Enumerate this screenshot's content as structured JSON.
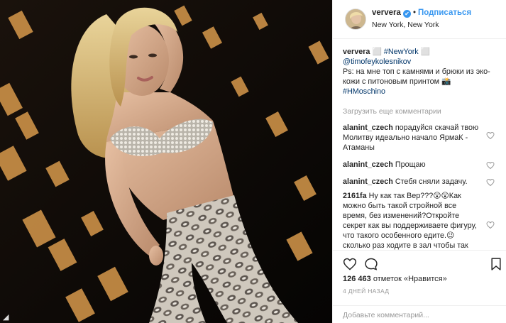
{
  "post": {
    "username": "ververa",
    "verified_mark": "✔",
    "separator": "•",
    "follow_label": "Подписаться",
    "location": "New York, New York",
    "photo_corner_glyph": "◢"
  },
  "caption": {
    "username": "ververa",
    "emoji1": "⬜",
    "hashtag1": "#NewYork",
    "emoji2": "⬜",
    "mention": "@timofeykolesnikov",
    "text": "Ps: на мне топ с камнями и брюки из эко-кожи с питоновым принтом 📸",
    "hashtag2": "#HMoschino"
  },
  "load_more_label": "Загрузить еще комментарии",
  "comments": [
    {
      "user": "alanint_czech",
      "text": "порадуйся скачай твою Молитву идеально начало ЯрмаК - Атаманы"
    },
    {
      "user": "alanint_czech",
      "text": "Прощаю"
    },
    {
      "user": "alanint_czech",
      "text": "Стебя сняли задачу."
    },
    {
      "user": "2161fa",
      "text": "Ну как так Вер???😲😲Как можно быть такой стройной все время, без изменений?Откройте секрет как вы поддерживаете фигуру, что такого особенного едите.😉 сколько раз ходите в зал чтобы так выглядеть???😍😍😍 @ververa"
    }
  ],
  "likes": {
    "count": "126 463",
    "text": "отметок «Нравится»"
  },
  "time_ago": "4 ДНЕЙ НАЗАД",
  "add_comment_placeholder": "Добавьте комментарий...",
  "icons": {
    "like": "heart-outline",
    "comment": "speech-bubble",
    "share": "paper-plane",
    "save": "bookmark"
  },
  "colors": {
    "link_blue": "#3897f0",
    "text": "#262626",
    "muted": "#999999",
    "hashtag": "#003569"
  }
}
